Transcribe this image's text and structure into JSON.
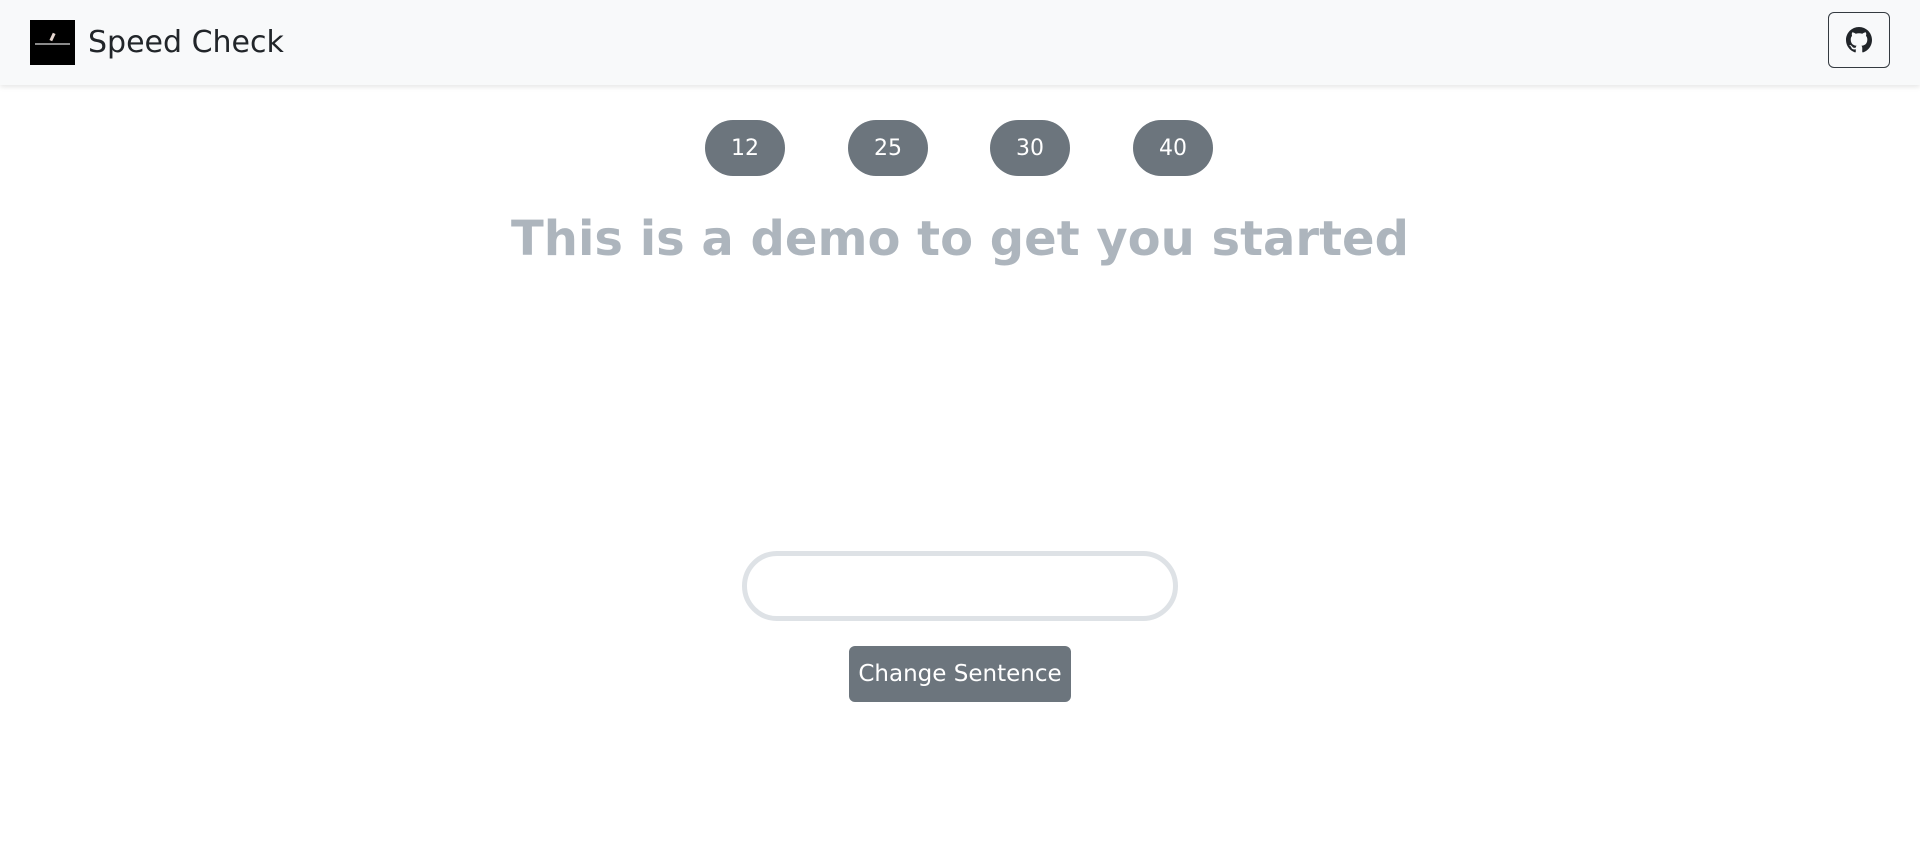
{
  "navbar": {
    "brand_name": "Speed Check",
    "github_icon": "github-icon"
  },
  "timers": [
    {
      "label": "12"
    },
    {
      "label": "25"
    },
    {
      "label": "30"
    },
    {
      "label": "40"
    }
  ],
  "sentence": "This is a demo to get you started",
  "typing_input": {
    "value": "",
    "placeholder": ""
  },
  "change_button": {
    "label": "Change Sentence"
  },
  "colors": {
    "button_gray": "#6c757d",
    "sentence_gray": "#adb5bd",
    "navbar_bg": "#f8f9fa",
    "input_border": "#dee2e6"
  }
}
